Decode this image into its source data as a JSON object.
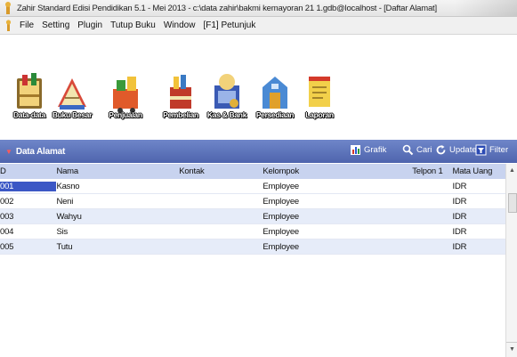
{
  "window": {
    "title": "Zahir Standard Edisi Pendidikan 5.1 - Mei 2013 - c:\\data zahir\\bakmi kemayoran 21 1.gdb@localhost - [Daftar Alamat]"
  },
  "menu": {
    "items": [
      "File",
      "Setting",
      "Plugin",
      "Tutup Buku",
      "Window",
      "[F1] Petunjuk"
    ]
  },
  "toolbar": {
    "buttons": [
      {
        "label": "Data-data",
        "icon": "data-data-icon"
      },
      {
        "label": "Buku Besar",
        "icon": "buku-besar-icon"
      },
      {
        "label": "Penjualan",
        "icon": "penjualan-icon"
      },
      {
        "label": "Pembelian",
        "icon": "pembelian-icon"
      },
      {
        "label": "Kas & Bank",
        "icon": "kas-bank-icon"
      },
      {
        "label": "Persediaan",
        "icon": "persediaan-icon"
      },
      {
        "label": "Laporan",
        "icon": "laporan-icon"
      }
    ]
  },
  "panel": {
    "title": "Data Alamat",
    "actions": {
      "grafik": "Grafik",
      "cari": "Cari",
      "update": "Update",
      "filter": "Filter"
    }
  },
  "table": {
    "columns": [
      "D",
      "Nama",
      "Kontak",
      "Kelompok",
      "Telpon 1",
      "Mata Uang"
    ],
    "rows": [
      [
        "001",
        "Kasno",
        "",
        "Employee",
        "",
        "IDR"
      ],
      [
        "002",
        "Neni",
        "",
        "Employee",
        "",
        "IDR"
      ],
      [
        "003",
        "Wahyu",
        "",
        "Employee",
        "",
        "IDR"
      ],
      [
        "004",
        "Sis",
        "",
        "Employee",
        "",
        "IDR"
      ],
      [
        "005",
        "Tutu",
        "",
        "Employee",
        "",
        "IDR"
      ]
    ]
  },
  "colors": {
    "header_blue": "#4e64ad",
    "row_alt": "#e6ecf9",
    "selected": "#3b57c5"
  }
}
